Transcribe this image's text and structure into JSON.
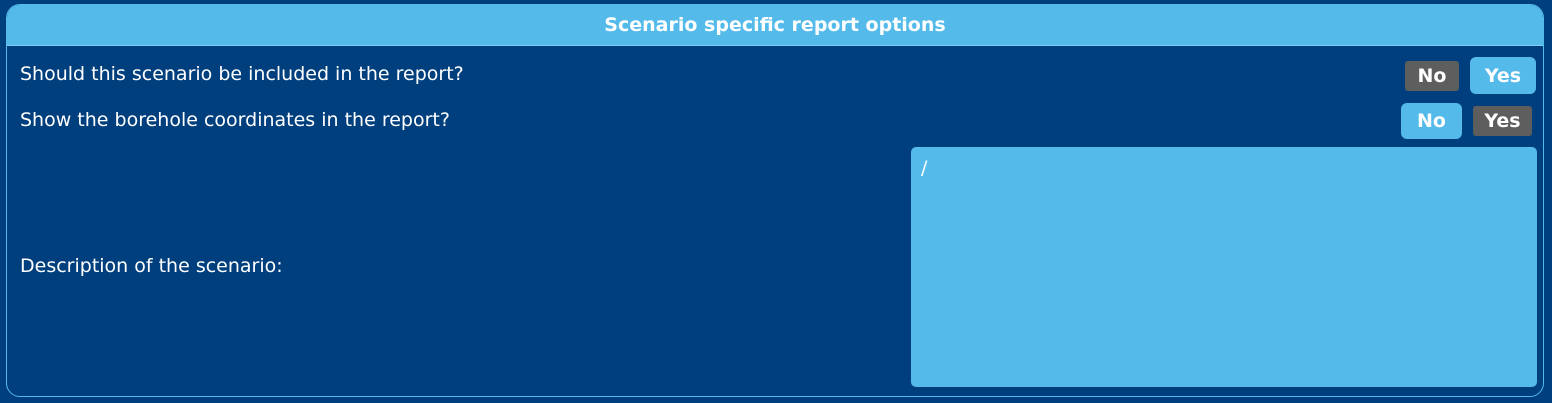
{
  "panel": {
    "title": "Scenario specific report options"
  },
  "rows": [
    {
      "label": "Should this scenario be included in the report?",
      "no_label": "No",
      "yes_label": "Yes",
      "selected": "Yes"
    },
    {
      "label": "Show the borehole coordinates in the report?",
      "no_label": "No",
      "yes_label": "Yes",
      "selected": "No"
    }
  ],
  "description": {
    "label": "Description of the scenario:",
    "value": "/"
  },
  "colors": {
    "background": "#003f7d",
    "accent": "#53baea",
    "unselected_button": "#5e5e5e",
    "text": "#ffffff"
  }
}
